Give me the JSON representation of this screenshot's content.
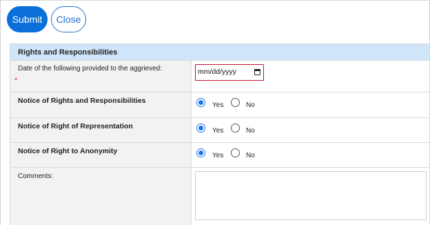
{
  "toolbar": {
    "submit_label": "Submit",
    "close_label": "Close"
  },
  "section": {
    "title": "Rights and Responsibilities"
  },
  "fields": {
    "date_label": "Date of the following provided to the aggrieved:",
    "required_marker": "*",
    "date_placeholder": "mm/dd/yyyy",
    "notice_rights": {
      "label": "Notice of Rights and Responsibilities",
      "yes_label": "Yes",
      "no_label": "No",
      "selected": "Yes"
    },
    "notice_representation": {
      "label": "Notice of Right of Representation",
      "yes_label": "Yes",
      "no_label": "No",
      "selected": "Yes"
    },
    "notice_anonymity": {
      "label": "Notice of Right to Anonymity",
      "yes_label": "Yes",
      "no_label": "No",
      "selected": "Yes"
    },
    "comments_label": "Comments:",
    "comments_value": ""
  },
  "colors": {
    "primary": "#0a6fd8",
    "header_bg": "#cfe6fa",
    "required": "#d22222",
    "invalid_border": "#c8102e"
  }
}
